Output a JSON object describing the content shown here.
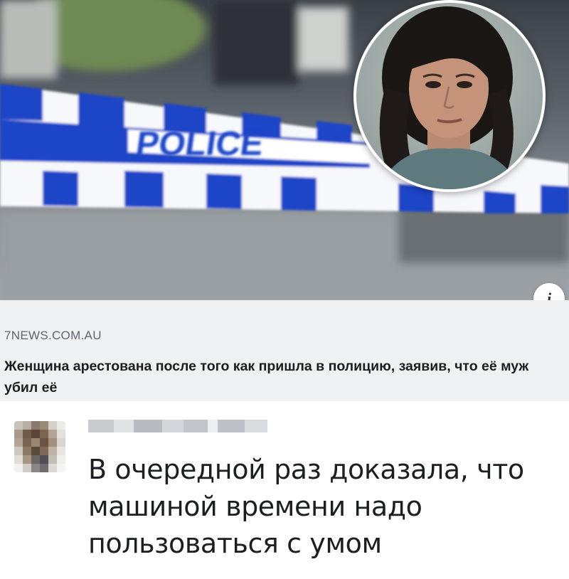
{
  "hero": {
    "tape_text": "POLICE",
    "tape_color": "#1b44c8",
    "icon": "info-icon",
    "info_glyph": "i"
  },
  "link_preview": {
    "source": "7NEWS.COM.AU",
    "title": "Женщина арестована после того как пришла в полицию, заявив, что её муж убил её"
  },
  "comment": {
    "text": "В очередной раз доказала, что машиной времени надо пользоваться с умом"
  }
}
